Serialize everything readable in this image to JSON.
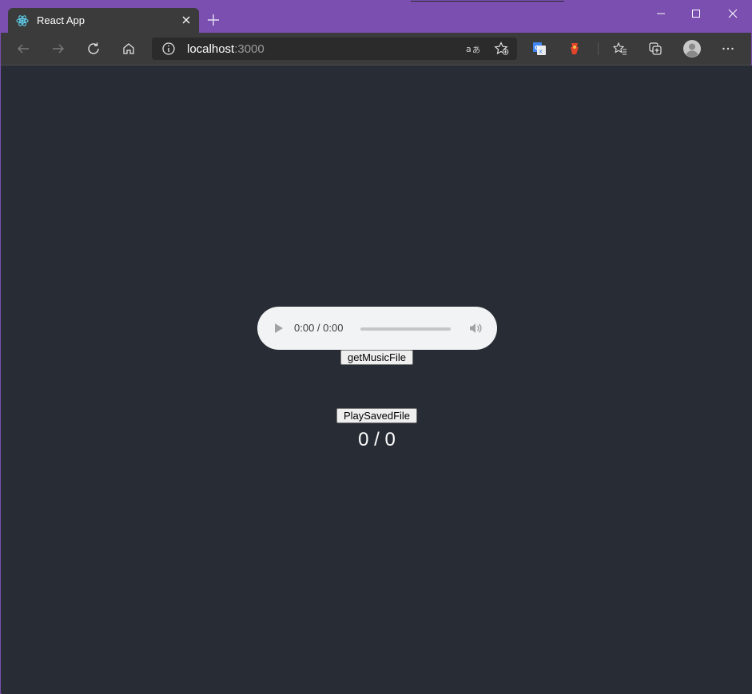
{
  "browser": {
    "tab": {
      "title": "React App"
    },
    "address_bar": {
      "host": "localhost",
      "port": ":3000"
    },
    "colors": {
      "frame": "#7a4fb0",
      "toolbar": "#3b3b3b",
      "page_bg": "#282c34"
    }
  },
  "page": {
    "audio_player": {
      "time": "0:00 / 0:00"
    },
    "get_music_button": "getMusicFile",
    "play_saved_button": "PlaySavedFile",
    "counter": "0 / 0"
  }
}
